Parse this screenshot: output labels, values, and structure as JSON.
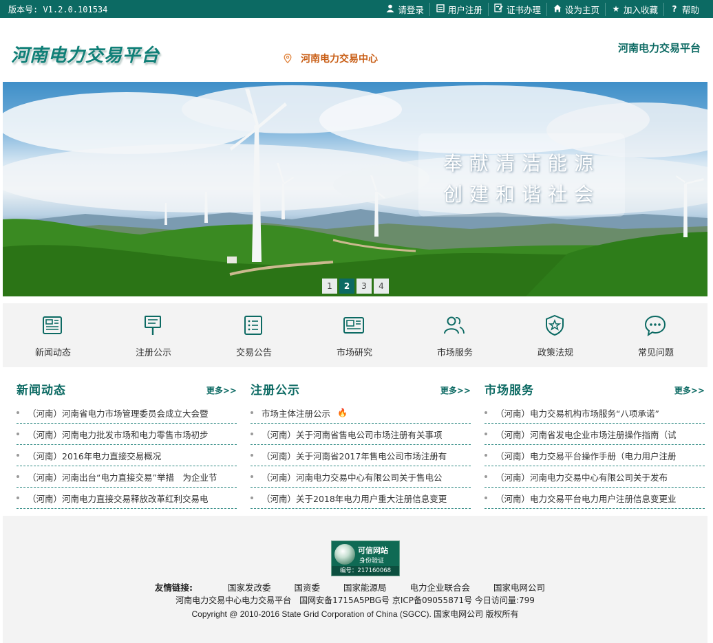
{
  "topbar": {
    "version": "版本号: V1.2.0.101534",
    "links": [
      {
        "label": "请登录",
        "icon": "user-icon"
      },
      {
        "label": "用户注册",
        "icon": "register-icon"
      },
      {
        "label": "证书办理",
        "icon": "certificate-icon"
      },
      {
        "label": "设为主页",
        "icon": "home-icon"
      },
      {
        "label": "加入收藏",
        "icon": "star-icon"
      },
      {
        "label": "帮助",
        "icon": "help-icon"
      }
    ]
  },
  "header": {
    "logo": "河南电力交易平台",
    "center": "河南电力交易中心",
    "right": "河南电力交易平台"
  },
  "banner": {
    "slogan_line1": "奉献清洁能源",
    "slogan_line2": "创建和谐社会",
    "pages": [
      "1",
      "2",
      "3",
      "4"
    ],
    "active_page": "2"
  },
  "nav": [
    {
      "label": "新闻动态",
      "icon": "newspaper-icon"
    },
    {
      "label": "注册公示",
      "icon": "signboard-icon"
    },
    {
      "label": "交易公告",
      "icon": "list-icon"
    },
    {
      "label": "市场研究",
      "icon": "document-chart-icon"
    },
    {
      "label": "市场服务",
      "icon": "users-icon"
    },
    {
      "label": "政策法规",
      "icon": "shield-star-icon"
    },
    {
      "label": "常见问题",
      "icon": "chat-bubble-icon"
    }
  ],
  "columns": [
    {
      "title": "新闻动态",
      "more": "更多>>",
      "items": [
        "（河南）河南省电力市场管理委员会成立大会暨",
        "（河南）河南电力批发市场和电力零售市场初步",
        "（河南）2016年电力直接交易概况",
        "（河南）河南出台“电力直接交易”举措　为企业节",
        "（河南）河南电力直接交易释放改革红利交易电"
      ]
    },
    {
      "title": "注册公示",
      "more": "更多>>",
      "items": [
        "市场主体注册公示",
        "（河南）关于河南省售电公司市场注册有关事项",
        "（河南）关于河南省2017年售电公司市场注册有",
        "（河南）河南电力交易中心有限公司关于售电公",
        "（河南）关于2018年电力用户重大注册信息变更"
      ]
    },
    {
      "title": "市场服务",
      "more": "更多>>",
      "items": [
        "（河南）电力交易机构市场服务“八项承诺”",
        "（河南）河南省发电企业市场注册操作指南（试",
        "（河南）电力交易平台操作手册（电力用户注册",
        "（河南）河南电力交易中心有限公司关于发布",
        "（河南）电力交易平台电力用户注册信息变更业"
      ]
    }
  ],
  "footer": {
    "badge_title": "可信网站",
    "badge_sub": "身份验证",
    "badge_no": "编号：217160068",
    "friends_label": "友情链接:",
    "friends": [
      "国家发改委",
      "国资委",
      "国家能源局",
      "电力企业联合会",
      "国家电网公司"
    ],
    "line2": "河南电力交易中心电力交易平台　国网安备1715A5PBG号 京ICP备09055871号 今日访问量:799",
    "line3": "Copyright @ 2010-2016 State Grid Corporation of China (SGCC). 国家电网公司 版权所有"
  }
}
